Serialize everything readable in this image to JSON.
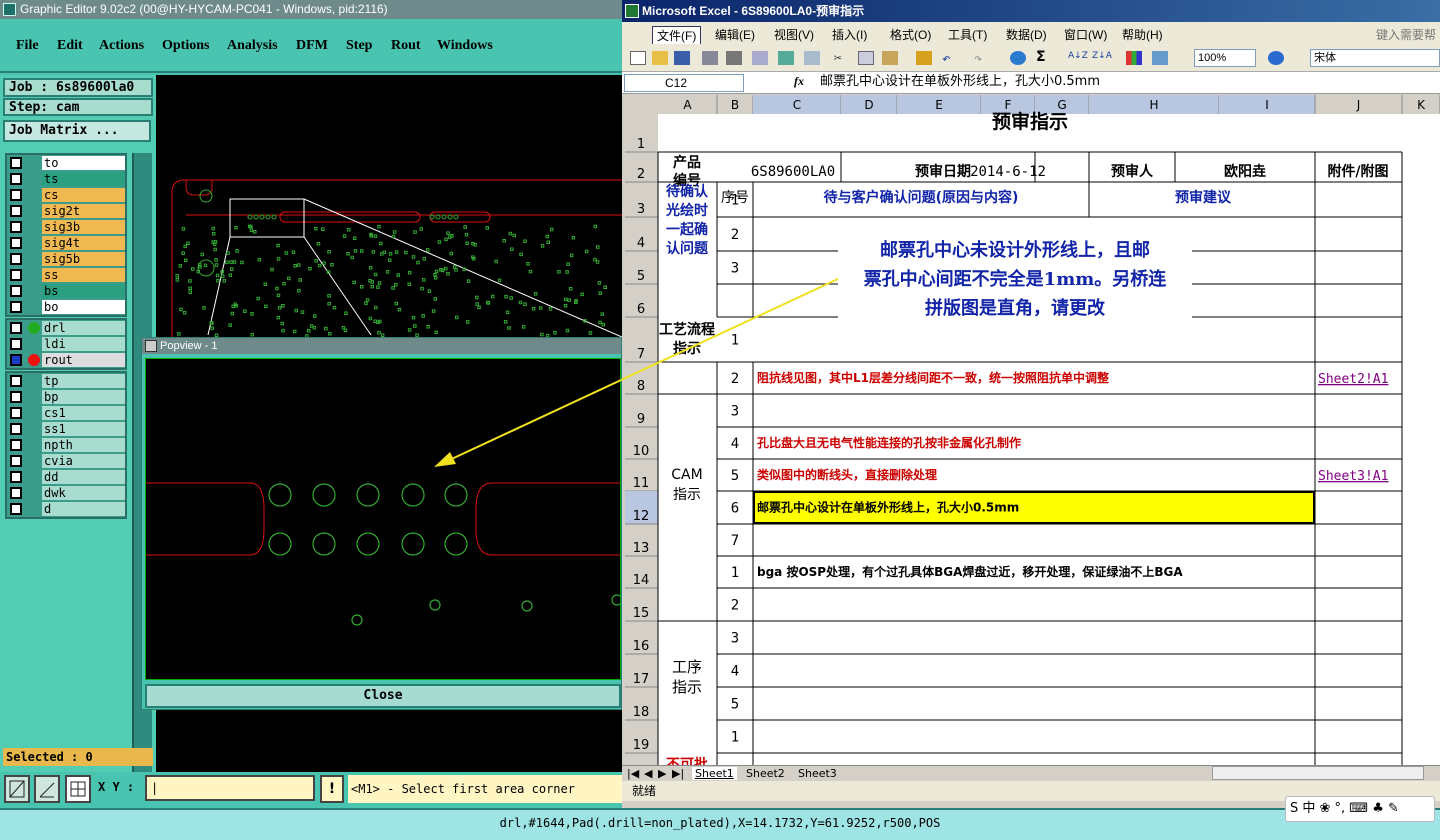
{
  "ge": {
    "title": "Graphic Editor 9.02c2 (00@HY-HYCAM-PC041 - Windows, pid:2116)",
    "menu": [
      "File",
      "Edit",
      "Actions",
      "Options",
      "Analysis",
      "DFM",
      "Step",
      "Rout",
      "Windows"
    ],
    "job": "Job : 6s89600la0",
    "step": "Step: cam",
    "job_matrix": "Job Matrix ...",
    "layers_board": [
      {
        "name": "to",
        "color": "#ffffff"
      },
      {
        "name": "ts",
        "color": "#2aa080"
      },
      {
        "name": "cs",
        "color": "#f0b850"
      },
      {
        "name": "sig2t",
        "color": "#f0b850"
      },
      {
        "name": "sig3b",
        "color": "#f0b850"
      },
      {
        "name": "sig4t",
        "color": "#f0b850"
      },
      {
        "name": "sig5b",
        "color": "#f0b850"
      },
      {
        "name": "ss",
        "color": "#f0b850"
      },
      {
        "name": "bs",
        "color": "#2aa080"
      },
      {
        "name": "bo",
        "color": "#ffffff"
      }
    ],
    "layers_drill": [
      {
        "name": "drl",
        "color": "#a7dccf",
        "dot": "#22aa22",
        "checked": false
      },
      {
        "name": "ldi",
        "color": "#a7dccf",
        "dot": "",
        "checked": false
      },
      {
        "name": "rout",
        "color": "#dddddd",
        "dot": "#ee1111",
        "checked": true
      }
    ],
    "layers_misc": [
      "tp",
      "bp",
      "cs1",
      "ss1",
      "npth",
      "cvia",
      "dd",
      "dwk",
      "d"
    ],
    "selected": "Selected : 0",
    "xy_label": "X Y :",
    "prompt": "<M1> - Select first area corner",
    "warn": "!",
    "status": "drl,#1644,Pad(.drill=non_plated),X=14.1732,Y=61.9252,r500,POS"
  },
  "popview": {
    "title": "Popview - 1",
    "close": "Close"
  },
  "excel": {
    "title": "Microsoft Excel - 6S89600LA0-预审指示",
    "menu": [
      "文件(F)",
      "编辑(E)",
      "视图(V)",
      "插入(I)",
      "格式(O)",
      "工具(T)",
      "数据(D)",
      "窗口(W)",
      "帮助(H)"
    ],
    "help_placeholder": "键入需要帮",
    "zoom": "100%",
    "font": "宋体",
    "name_box": "C12",
    "fx": "fx",
    "formula": "邮票孔中心设计在单板外形线上，孔大小0.5mm",
    "columns": [
      "A",
      "B",
      "C",
      "D",
      "E",
      "F",
      "G",
      "H",
      "I",
      "J",
      "K"
    ],
    "rows": [
      "1",
      "2",
      "3",
      "4",
      "5",
      "6",
      "7",
      "8",
      "9",
      "10",
      "11",
      "12",
      "13",
      "14",
      "15",
      "16",
      "17",
      "18",
      "19"
    ],
    "cells": {
      "title": "预审指示",
      "product_no_label": "产品编号",
      "product_no": "6S89600LA0",
      "review_date_label": "预审日期",
      "review_date": "2014-6-12",
      "reviewer_label": "预审人",
      "reviewer": "欧阳垚",
      "attach_label": "附件/附图",
      "confirm_section": "待确认光绘时一起确认问题",
      "seq_label": "序号",
      "issues_header": "待与客户确认问题(原因与内容)",
      "suggest_header": "预审建议",
      "process_label": "工艺流程指示",
      "cam_label": "CAM指示",
      "procedure_label": "工序指示",
      "no_approve": "不可批",
      "seq_values": [
        "1",
        "2",
        "3",
        "1",
        "2",
        "3",
        "4",
        "5",
        "6",
        "7",
        "1",
        "2",
        "3",
        "4",
        "5",
        "1"
      ],
      "cam_items": [
        {
          "text": "阻抗线见图，其中L1层差分线间距不一致，统一按照阻抗单中调整",
          "link": "Sheet2!A1"
        },
        {
          "text": "",
          "link": ""
        },
        {
          "text": "孔比盘大且无电气性能连接的孔按非金属化孔制作",
          "link": ""
        },
        {
          "text": "类似图中的断线头，直接删除处理",
          "link": "Sheet3!A1"
        },
        {
          "text": "邮票孔中心设计在单板外形线上，孔大小0.5mm",
          "link": ""
        },
        {
          "text": "",
          "link": ""
        },
        {
          "text": "bga 按OSP处理，有个过孔具体BGA焊盘过近，移开处理，保证绿油不上BGA",
          "link": ""
        }
      ]
    },
    "annotation": [
      "邮票孔中心未设计外形线上，且邮",
      "票孔中心间距不完全是1mm。另桥连",
      "拼版图是直角，请更改"
    ],
    "sheets": [
      "Sheet1",
      "Sheet2",
      "Sheet3"
    ],
    "status": "就绪",
    "ime": "S 中 ❀ °, ⌨ ♣ ✎"
  }
}
